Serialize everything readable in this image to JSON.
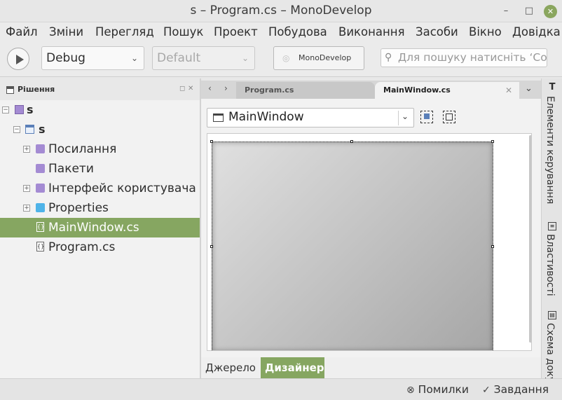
{
  "window": {
    "title": "s – Program.cs – MonoDevelop"
  },
  "menu": [
    "Файл",
    "Зміни",
    "Перегляд",
    "Пошук",
    "Проект",
    "Побудова",
    "Виконання",
    "Засоби",
    "Вікно",
    "Довідка"
  ],
  "toolbar": {
    "config": "Debug",
    "platform": "Default",
    "status": "MonoDevelop",
    "search_placeholder": "Для пошуку натисніть ‘Control+,’"
  },
  "solution_pad": {
    "title": "Рішення",
    "items": [
      {
        "label": "s",
        "expander": "−",
        "icon": "solution-icon"
      },
      {
        "label": "s",
        "expander": "−",
        "icon": "project-icon"
      },
      {
        "label": "Посилання",
        "expander": "+",
        "icon": "references-folder-icon"
      },
      {
        "label": "Пакети",
        "expander": "",
        "icon": "packages-folder-icon"
      },
      {
        "label": "Інтерфейс користувача",
        "expander": "+",
        "icon": "ui-folder-icon"
      },
      {
        "label": "Properties",
        "expander": "+",
        "icon": "folder-icon"
      },
      {
        "label": "MainWindow.cs",
        "expander": "",
        "icon": "csharp-file-icon",
        "selected": true
      },
      {
        "label": "Program.cs",
        "expander": "",
        "icon": "csharp-file-icon"
      }
    ]
  },
  "tabs": [
    {
      "label": "Program.cs",
      "active": false
    },
    {
      "label": "MainWindow.cs",
      "active": true
    }
  ],
  "designer": {
    "widget_selector": "MainWindow",
    "view_tabs": {
      "source": "Джерело",
      "designer": "Дизайнер"
    }
  },
  "right_pads": [
    "Елементи керування",
    "Властивості",
    "Схема документа"
  ],
  "statusbar": {
    "errors": "Помилки",
    "tasks": "Завдання"
  },
  "colors": {
    "accent": "#86a661",
    "close_button": "#8aa65e"
  }
}
